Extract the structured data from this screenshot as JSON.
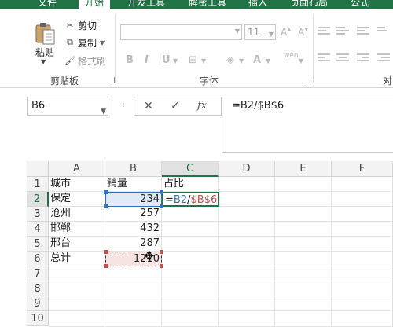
{
  "ribbon_tabs": [
    "文件",
    "开始",
    "开发工具",
    "解密工具",
    "插入",
    "页面布局",
    "公式"
  ],
  "clipboard": {
    "paste_label": "粘贴",
    "cut_label": "剪切",
    "copy_label": "复制",
    "format_painter_label": "格式刷",
    "group_label": "剪贴板"
  },
  "font": {
    "name_value": "",
    "size_value": "11",
    "group_label": "字体",
    "phonetic_label": "wén"
  },
  "alignment": {
    "group_label": "对"
  },
  "formula_bar": {
    "name_box": "B6",
    "cancel_symbol": "✕",
    "enter_symbol": "✓",
    "fx_symbol": "fx",
    "formula": "=B2/$B$6"
  },
  "sheet": {
    "columns": [
      "A",
      "B",
      "C",
      "D",
      "E",
      "F"
    ],
    "rows": [
      "1",
      "2",
      "3",
      "4",
      "5",
      "6",
      "7",
      "8",
      "9",
      "10"
    ],
    "cells": {
      "A1": "城市",
      "B1": "销量",
      "C1": "占比",
      "A2": "保定",
      "B2": "234",
      "A3": "沧州",
      "B3": "257",
      "A4": "邯郸",
      "B4": "432",
      "A5": "邢台",
      "B5": "287",
      "A6": "总计",
      "B6": "1210"
    },
    "edit_cell": {
      "prefix": "=",
      "ref1": "B2",
      "sep": "/",
      "ref2": "$B$6"
    }
  },
  "colors": {
    "accent": "#217346",
    "ref_blue": "#3a6fb5",
    "ref_red": "#c0504d"
  }
}
